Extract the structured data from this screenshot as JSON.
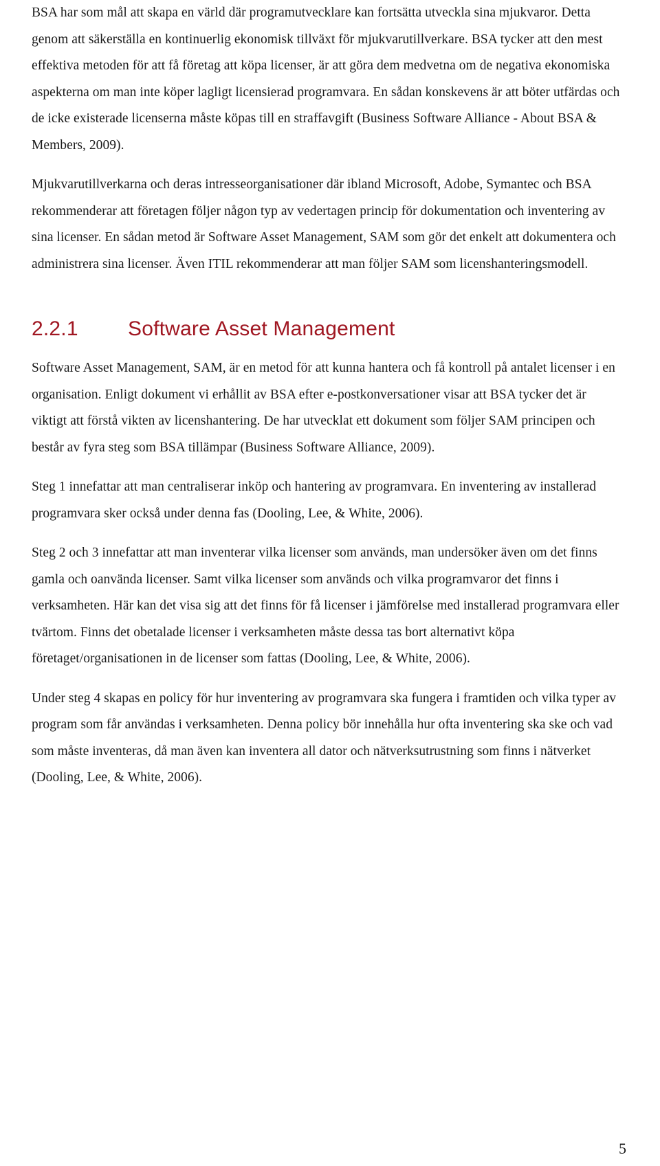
{
  "document": {
    "language": "sv",
    "page_number": "5",
    "heading_color": "#a01722",
    "body_color": "#1a1a1a"
  },
  "body": {
    "paragraphs": [
      {
        "id": "p1",
        "text": "BSA har som mål att skapa en värld där programutvecklare kan fortsätta utveckla sina mjukvaror. Detta genom att säkerställa en kontinuerlig ekonomisk tillväxt för mjukvarutillverkare. BSA tycker att den mest effektiva metoden för att få företag att köpa licenser, är att göra dem medvetna om de negativa ekonomiska aspekterna om man inte köper lagligt licensierad programvara. En sådan konskevens är att böter utfärdas och de icke existerade licenserna måste köpas till en straffavgift (Business Software Alliance - About BSA & Members, 2009)."
      },
      {
        "id": "p2",
        "text": "Mjukvarutillverkarna och deras intresseorganisationer där ibland Microsoft, Adobe, Symantec och BSA rekommenderar att företagen följer någon typ av vedertagen princip för dokumentation och inventering av sina licenser. En sådan metod är Software Asset Management, SAM som gör det enkelt att dokumentera och administrera sina licenser. Även ITIL rekommenderar att man följer SAM som licenshanteringsmodell."
      }
    ]
  },
  "section": {
    "number": "2.2.1",
    "title": "Software Asset Management",
    "paragraphs": [
      {
        "id": "s1",
        "text": "Software Asset Management, SAM, är en metod för att kunna hantera och få kontroll på antalet licenser i en organisation. Enligt dokument vi erhållit av BSA efter e-postkonversationer visar att BSA tycker det är viktigt att förstå vikten av licenshantering. De har utvecklat ett dokument som följer SAM principen och består av fyra steg som BSA tillämpar (Business Software Alliance, 2009)."
      },
      {
        "id": "s2",
        "text": "Steg 1 innefattar att man centraliserar inköp och hantering av programvara. En inventering av installerad programvara sker också under denna fas (Dooling, Lee, & White, 2006)."
      },
      {
        "id": "s3",
        "text": "Steg 2 och 3 innefattar att man inventerar vilka licenser som används, man undersöker även om det finns gamla och oanvända licenser. Samt vilka licenser som används och vilka programvaror det finns i verksamheten. Här kan det visa sig att det finns för få licenser i jämförelse med installerad programvara eller tvärtom. Finns det obetalade licenser i verksamheten måste dessa tas bort alternativt köpa företaget/organisationen in de licenser som fattas (Dooling, Lee, & White, 2006)."
      },
      {
        "id": "s4",
        "text": "Under steg 4 skapas en policy för hur inventering av programvara ska fungera i framtiden och vilka typer av program som får användas i verksamheten. Denna policy bör innehålla hur ofta inventering ska ske och vad som måste inventeras, då man även kan inventera all dator och nätverksutrustning som finns i nätverket (Dooling, Lee, & White, 2006)."
      }
    ]
  }
}
